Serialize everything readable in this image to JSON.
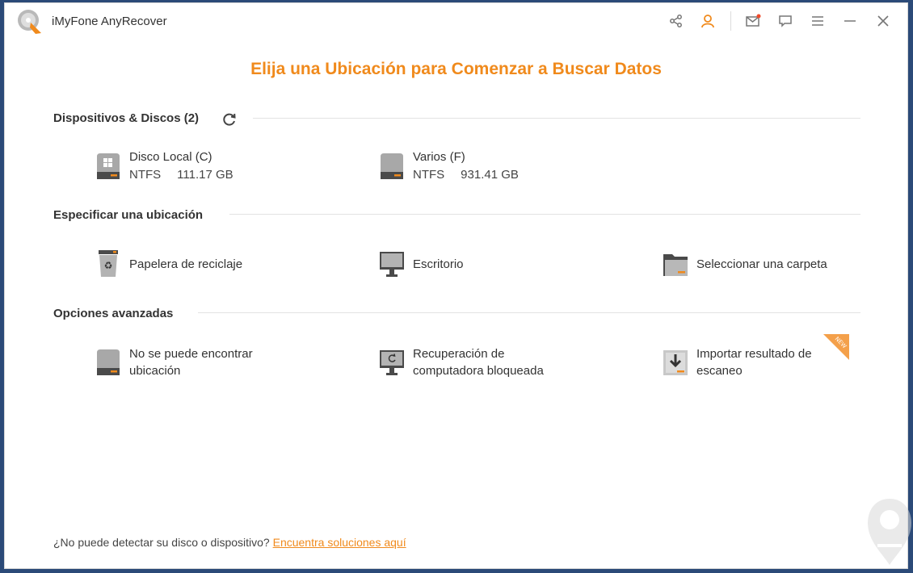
{
  "window": {
    "title": "iMyFone AnyRecover"
  },
  "toolbar": {
    "icons": [
      "share-icon",
      "user-icon",
      "mail-icon",
      "feedback-icon",
      "menu-icon",
      "minimize-icon",
      "close-icon"
    ]
  },
  "headline": "Elija una Ubicación para Comenzar a Buscar Datos",
  "sections": {
    "devices": {
      "title": "Dispositivos & Discos (2)",
      "items": [
        {
          "name": "Disco Local (C)",
          "fs": "NTFS",
          "size": "111.17 GB"
        },
        {
          "name": "Varios (F)",
          "fs": "NTFS",
          "size": "931.41 GB"
        }
      ]
    },
    "location": {
      "title": "Especificar una ubicación",
      "items": [
        {
          "label": "Papelera de reciclaje"
        },
        {
          "label": "Escritorio"
        },
        {
          "label": "Seleccionar una carpeta"
        }
      ]
    },
    "advanced": {
      "title": "Opciones avanzadas",
      "items": [
        {
          "line1": "No se puede encontrar",
          "line2": "ubicación"
        },
        {
          "line1": "Recuperación de",
          "line2": "computadora bloqueada"
        },
        {
          "line1": "Importar resultado de",
          "line2": "escaneo",
          "badge": "NEW"
        }
      ]
    }
  },
  "footer": {
    "question": "¿No puede detectar su disco o dispositivo?",
    "link": "Encuentra soluciones aquí"
  },
  "colors": {
    "accent": "#f08a1c",
    "text": "#333333",
    "drive_grey": "#a8a8a8"
  }
}
